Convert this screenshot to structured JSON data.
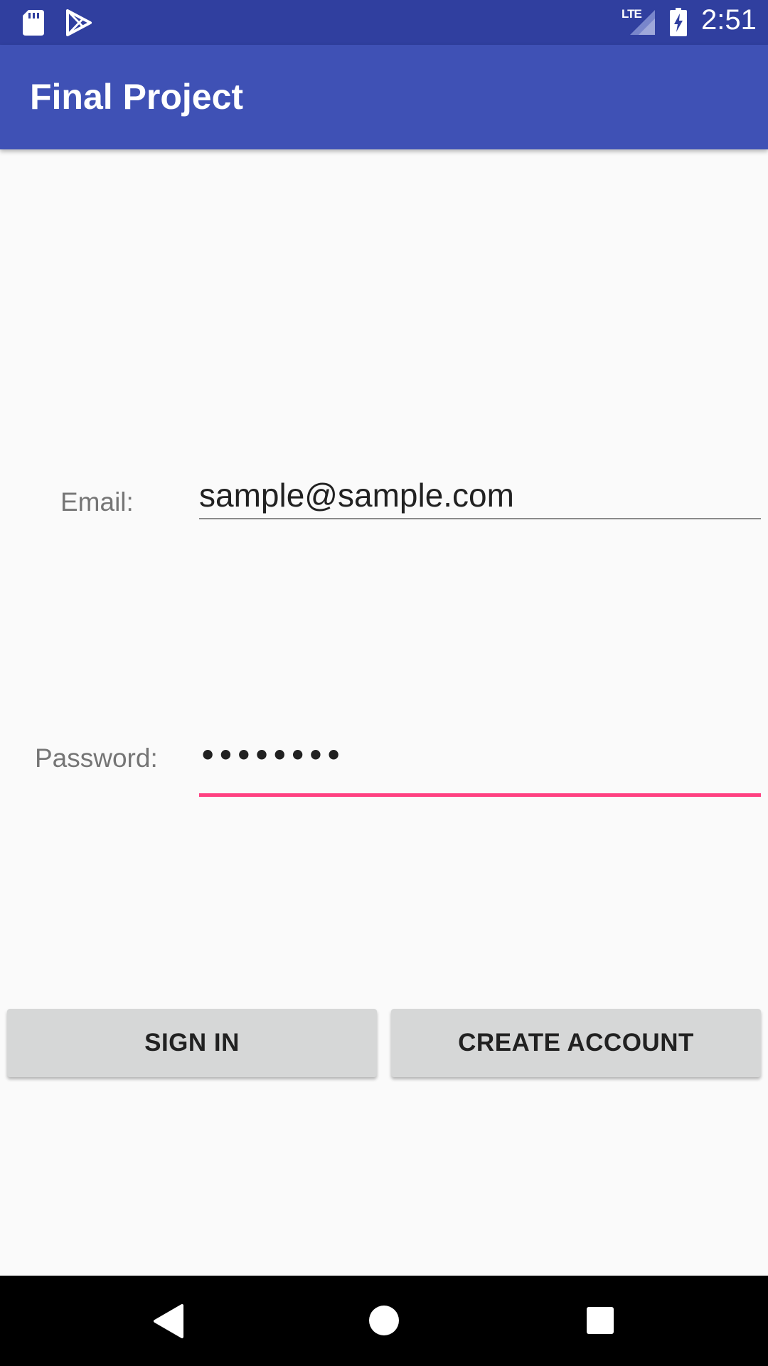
{
  "status_bar": {
    "time": "2:51",
    "network": "LTE",
    "icons": [
      "sd-card-icon",
      "play-store-icon",
      "lte-signal-icon",
      "battery-charging-icon"
    ]
  },
  "app_bar": {
    "title": "Final Project"
  },
  "form": {
    "email_label": "Email:",
    "email_value": "sample@sample.com",
    "password_label": "Password:",
    "password_mask": "••••••••"
  },
  "buttons": {
    "sign_in": "SIGN IN",
    "create_account": "CREATE ACCOUNT"
  },
  "nav_bar": {
    "icons": [
      "back-icon",
      "home-icon",
      "recents-icon"
    ]
  },
  "colors": {
    "status_bar": "#303f9f",
    "app_bar": "#3f51b5",
    "accent": "#ff4081",
    "button": "#d6d7d7",
    "background": "#fafafa"
  }
}
